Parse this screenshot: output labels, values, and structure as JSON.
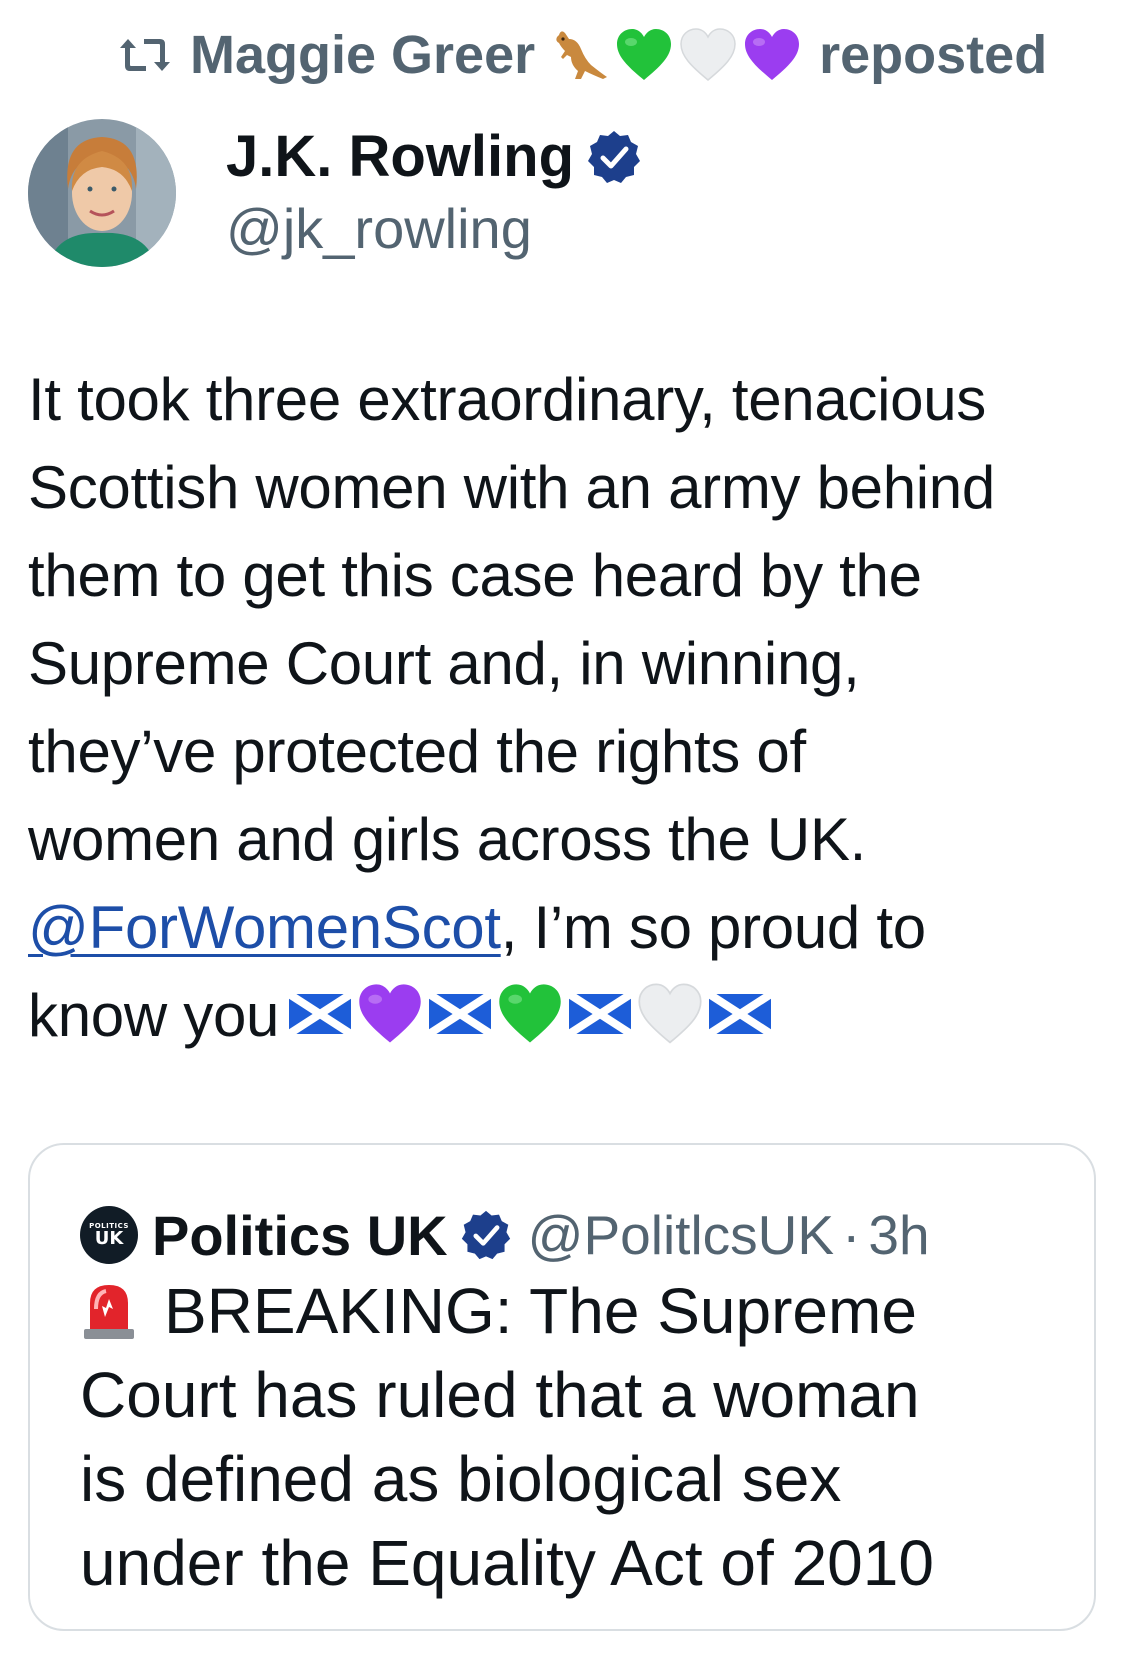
{
  "repost": {
    "icon": "repost-icon",
    "name": "Maggie Greer",
    "emojis": [
      "kangaroo",
      "green-heart",
      "white-heart",
      "purple-heart"
    ],
    "suffix": "reposted"
  },
  "author": {
    "name": "J.K. Rowling",
    "handle": "@jk_rowling",
    "verified": true
  },
  "tweet": {
    "lines": [
      "It took three extraordinary, tenacious",
      "Scottish women with an army behind",
      "them to get this case heard by the",
      "Supreme Court and, in winning,",
      "they’ve protected the rights of",
      "women and girls across the UK."
    ],
    "mention": "@ForWomenScot",
    "mention_rest": ", I’m so proud to",
    "last_line": "know you",
    "trailing_emojis": [
      "scotland-flag",
      "purple-heart",
      "scotland-flag",
      "green-heart",
      "scotland-flag",
      "white-heart",
      "scotland-flag"
    ]
  },
  "quote": {
    "avatar_small": "POLITICS",
    "avatar_big": "UK",
    "name": "Politics UK",
    "handle": "@PolitlcsUK",
    "dot": "·",
    "time": "3h",
    "lead_emoji": "siren",
    "lines": [
      "BREAKING: The Supreme",
      "Court has ruled that a woman",
      "is defined as biological sex",
      "under the Equality Act of 2010"
    ]
  },
  "colors": {
    "secondary_text": "#536471",
    "primary_text": "#0f1419",
    "verified_blue": "#1d3f8c",
    "link": "#1d4ea8",
    "green_heart": "#22c23a",
    "purple_heart": "#9b3df0",
    "white_heart": "#e8e8ea",
    "saltire_blue": "#1d5dd8"
  }
}
